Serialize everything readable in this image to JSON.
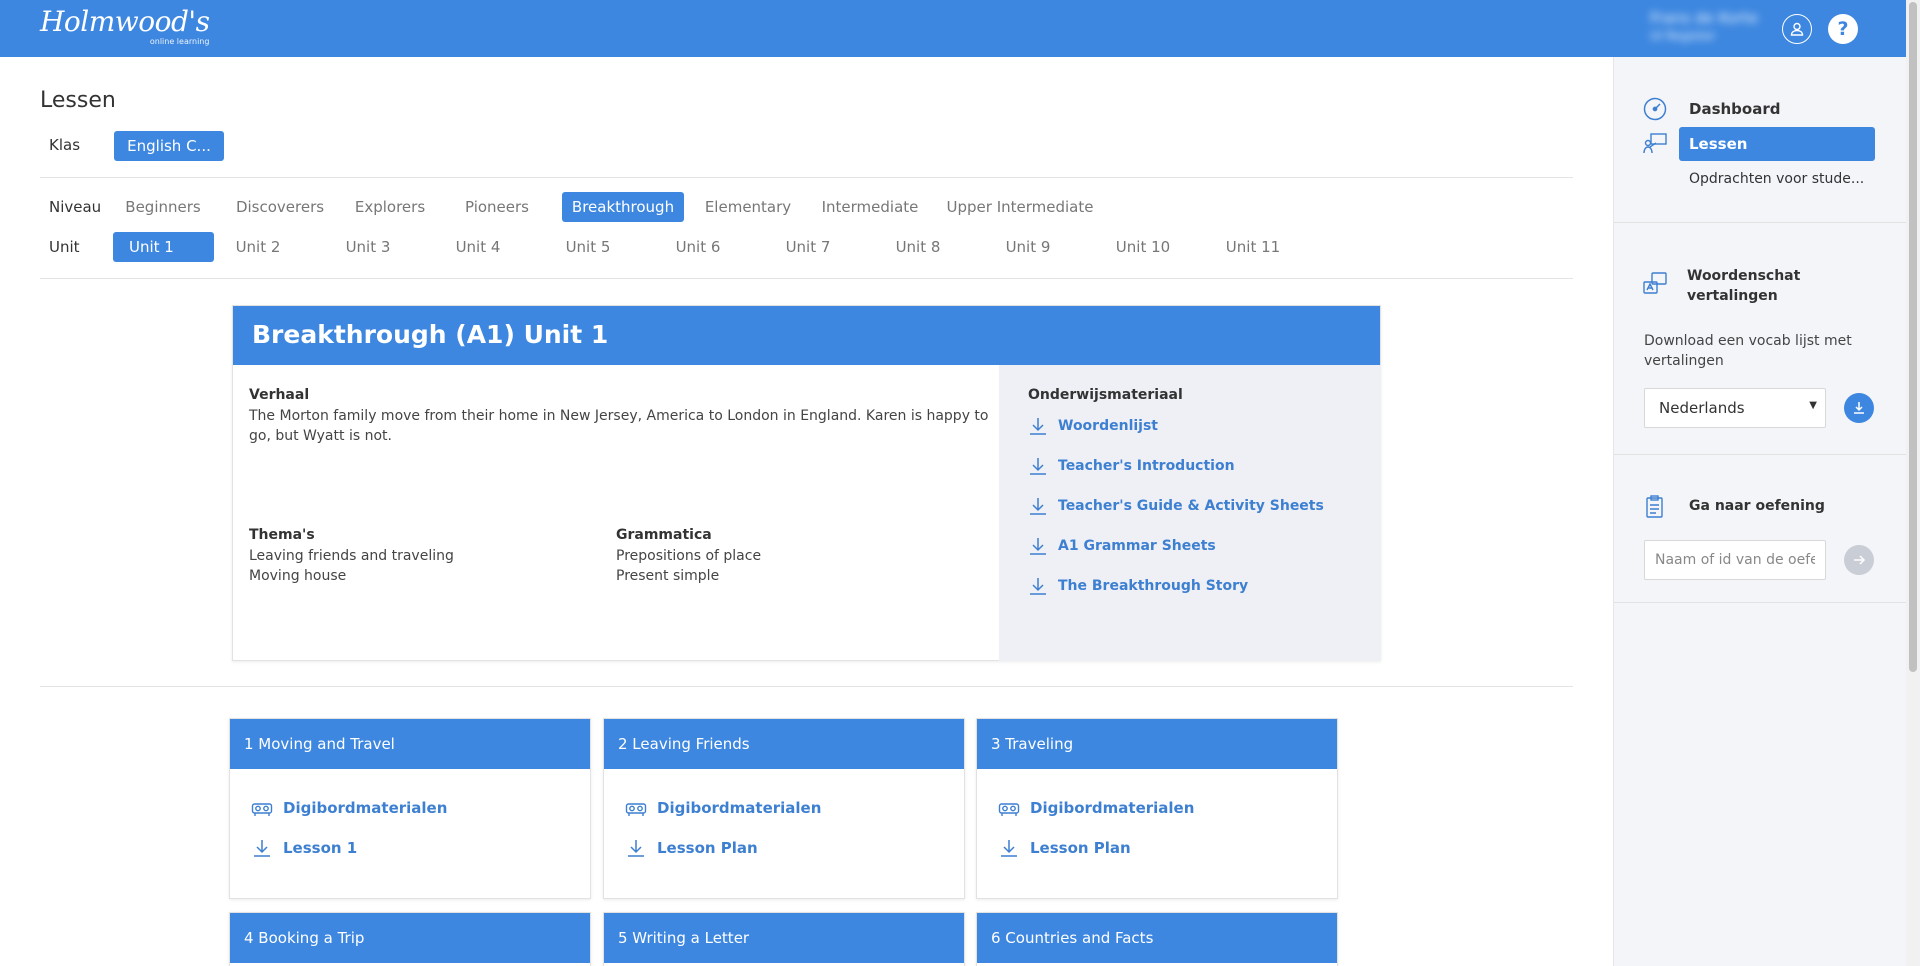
{
  "header": {
    "logo_text": "Holmwood's",
    "logo_sub": "online learning",
    "user_name": "Frans de Korte",
    "user_role": "UI Register",
    "help_label": "?"
  },
  "page": {
    "title": "Lessen",
    "klas_label": "Klas",
    "klas_value": "English C...",
    "niveau_label": "Niveau",
    "unit_label": "Unit",
    "niveaus": [
      "Beginners",
      "Discoverers",
      "Explorers",
      "Pioneers",
      "Breakthrough",
      "Elementary",
      "Intermediate",
      "Upper Intermediate"
    ],
    "niveau_active": "Breakthrough",
    "units": [
      "Unit 1",
      "Unit 2",
      "Unit 3",
      "Unit 4",
      "Unit 5",
      "Unit 6",
      "Unit 7",
      "Unit 8",
      "Unit 9",
      "Unit 10",
      "Unit 11"
    ],
    "unit_active": "Unit 1"
  },
  "summary": {
    "title": "Breakthrough (A1) Unit 1",
    "verhaal_label": "Verhaal",
    "verhaal_text": "The Morton family move from their home in New Jersey, America to London in England. Karen is happy to go, but Wyatt is not.",
    "themas_label": "Thema's",
    "themas": [
      "Leaving friends and traveling",
      "Moving house"
    ],
    "grammatica_label": "Grammatica",
    "grammatica": [
      "Prepositions of place",
      "Present simple"
    ],
    "materials_label": "Onderwijsmateriaal",
    "materials": [
      "Woordenlijst",
      "Teacher's Introduction",
      "Teacher's Guide & Activity Sheets",
      "A1 Grammar Sheets",
      "The Breakthrough Story"
    ]
  },
  "lessons": [
    {
      "title": "1 Moving and Travel",
      "links": [
        "Digibordmaterialen",
        "Lesson 1"
      ]
    },
    {
      "title": "2 Leaving Friends",
      "links": [
        "Digibordmaterialen",
        "Lesson Plan"
      ]
    },
    {
      "title": "3 Traveling",
      "links": [
        "Digibordmaterialen",
        "Lesson Plan"
      ]
    },
    {
      "title": "4 Booking a Trip"
    },
    {
      "title": "5 Writing a Letter"
    },
    {
      "title": "6 Countries and Facts"
    }
  ],
  "sidebar": {
    "nav": [
      {
        "label": "Dashboard",
        "icon": "gauge-icon"
      },
      {
        "label": "Lessen",
        "icon": "teacher-board-icon"
      },
      {
        "label": "Opdrachten voor stude..."
      }
    ],
    "vocab_title_1": "Woordenschat",
    "vocab_title_2": "vertalingen",
    "vocab_desc_1": "Download een vocab lijst met",
    "vocab_desc_2": "vertalingen",
    "language_selected": "Nederlands",
    "exercise_title": "Ga naar oefening",
    "exercise_placeholder": "Naam of id van de oefening"
  },
  "colors": {
    "accent": "#3d87e0",
    "link": "#3d7fd1",
    "panel": "#eef0f6",
    "sidebar": "#f4f5f9"
  }
}
